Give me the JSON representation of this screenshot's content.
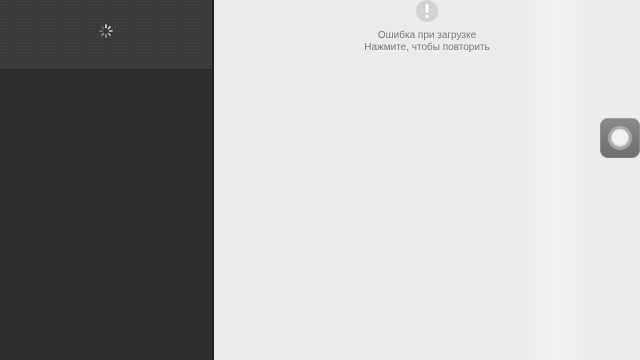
{
  "sidebar": {
    "status_icon": "loading-spinner-icon"
  },
  "main": {
    "error": {
      "icon": "exclamation-icon",
      "title": "Ошибка при загрузке",
      "retry_hint": "Нажмите, чтобы повторить"
    }
  },
  "overlay": {
    "assistive_touch_icon": "assistive-touch-icon"
  },
  "colors": {
    "sidebar_bg": "#2f2f2f",
    "sidebar_header_bg": "#3a3a3a",
    "content_bg": "#ebebeb",
    "error_text": "#7a7a7a",
    "error_icon": "#cfcfcf"
  }
}
